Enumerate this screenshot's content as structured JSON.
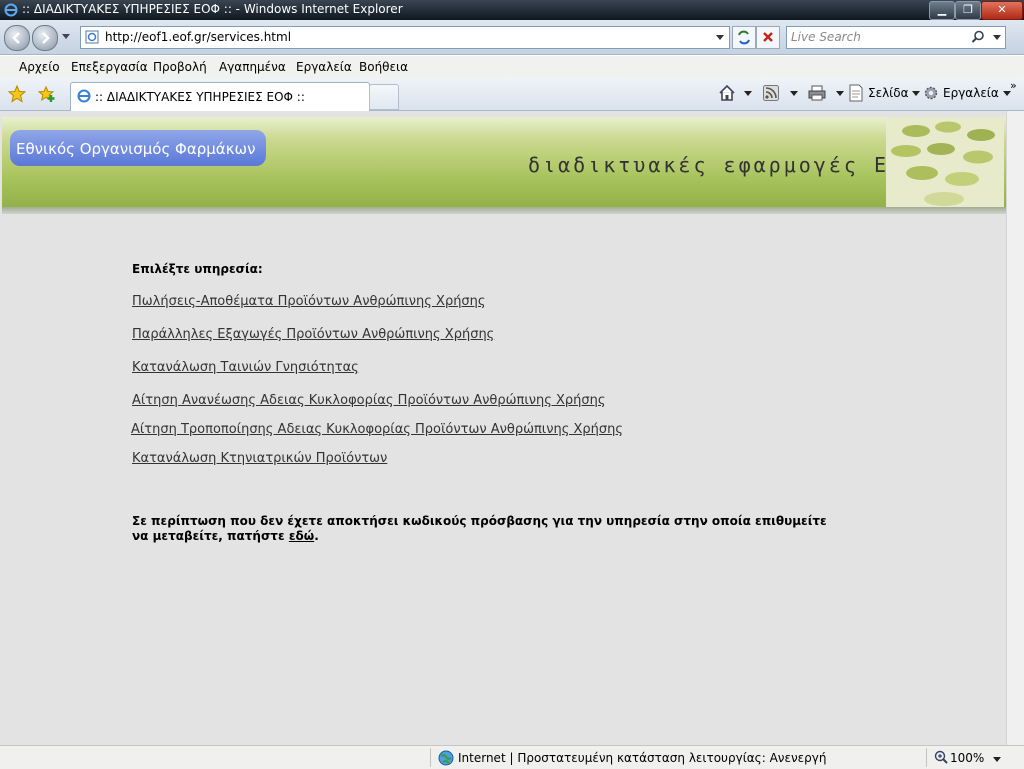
{
  "window": {
    "title": ":: ΔΙΑΔΙΚΤΥΑΚΕΣ ΥΠΗΡΕΣΙΕΣ ΕΟΦ :: - Windows Internet Explorer"
  },
  "address": {
    "url": "http://eof1.eof.gr/services.html"
  },
  "search": {
    "placeholder": "Live Search"
  },
  "menu": {
    "items": [
      "Αρχείο",
      "Επεξεργασία",
      "Προβολή",
      "Αγαπημένα",
      "Εργαλεία",
      "Βοήθεια"
    ]
  },
  "tab": {
    "title": ":: ΔΙΑΔΙΚΤΥΑΚΕΣ ΥΠΗΡΕΣΙΕΣ ΕΟΦ ::"
  },
  "commands": {
    "page": "Σελίδα",
    "tools": "Εργαλεία"
  },
  "banner": {
    "org_name": "Εθνικός Οργανισμός Φαρμάκων",
    "slogan": "διαδικτυακές εφαρμογές ΕΟΦ"
  },
  "content": {
    "heading": "Επιλέξτε υπηρεσία:",
    "links": [
      "Πωλήσεις-Αποθέματα Προϊόντων Ανθρώπινης Χρήσης",
      "Παράλληλες Εξαγωγές Προϊόντων Ανθρώπινης Χρήσης",
      "Κατανάλωση Ταινιών Γνησιότητας",
      "Αίτηση Ανανέωσης Αδειας Κυκλοφορίας Προϊόντων Ανθρώπινης Χρήσης",
      "Αίτηση Τροποποίησης Αδειας Κυκλοφορίας Προϊόντων Ανθρώπινης Χρήσης",
      "Κατανάλωση Κτηνιατρικών Προϊόντων"
    ],
    "notice_text": "Σε περίπτωση που δεν έχετε αποκτήσει κωδικούς πρόσβασης για την υπηρεσία στην οποία επιθυμείτε να μεταβείτε, πατήστε ",
    "notice_link": "εδώ",
    "notice_end": "."
  },
  "status": {
    "zone": "Internet | Προστατευμένη κατάσταση λειτουργίας: Ανενεργή",
    "zoom": "100%"
  },
  "colors": {
    "banner_green": "#a6c25a",
    "org_pill_blue": "#5a78d8",
    "content_bg": "#e3e3e3"
  }
}
